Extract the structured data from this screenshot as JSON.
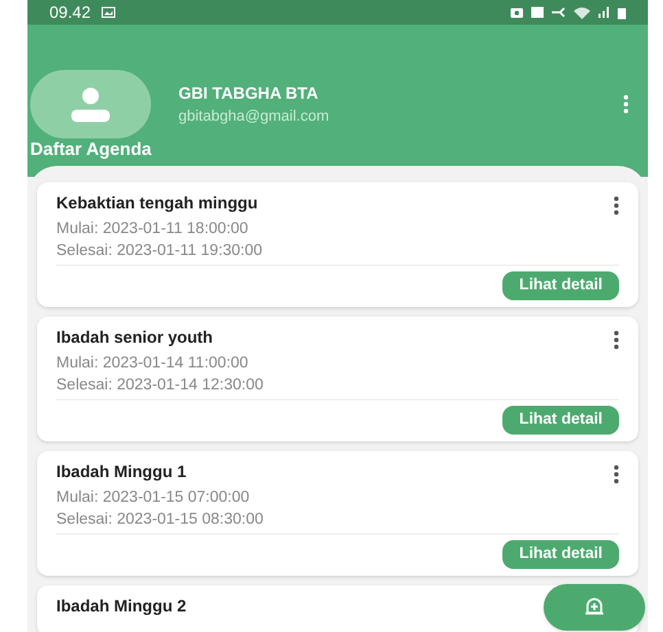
{
  "status_bar": {
    "time": "09.42"
  },
  "profile": {
    "name": "GBI TABGHA BTA",
    "email": "gbitabgha@gmail.com"
  },
  "section_title": "Daftar Agenda",
  "agenda": [
    {
      "title": "Kebaktian tengah minggu",
      "start": "Mulai: 2023-01-11 18:00:00",
      "end": "Selesai: 2023-01-11 19:30:00",
      "button": "Lihat detail"
    },
    {
      "title": "Ibadah senior youth",
      "start": "Mulai: 2023-01-14 11:00:00",
      "end": "Selesai: 2023-01-14 12:30:00",
      "button": "Lihat detail"
    },
    {
      "title": "Ibadah Minggu 1",
      "start": "Mulai: 2023-01-15 07:00:00",
      "end": "Selesai: 2023-01-15 08:30:00",
      "button": "Lihat detail"
    },
    {
      "title": "Ibadah Minggu 2"
    }
  ]
}
